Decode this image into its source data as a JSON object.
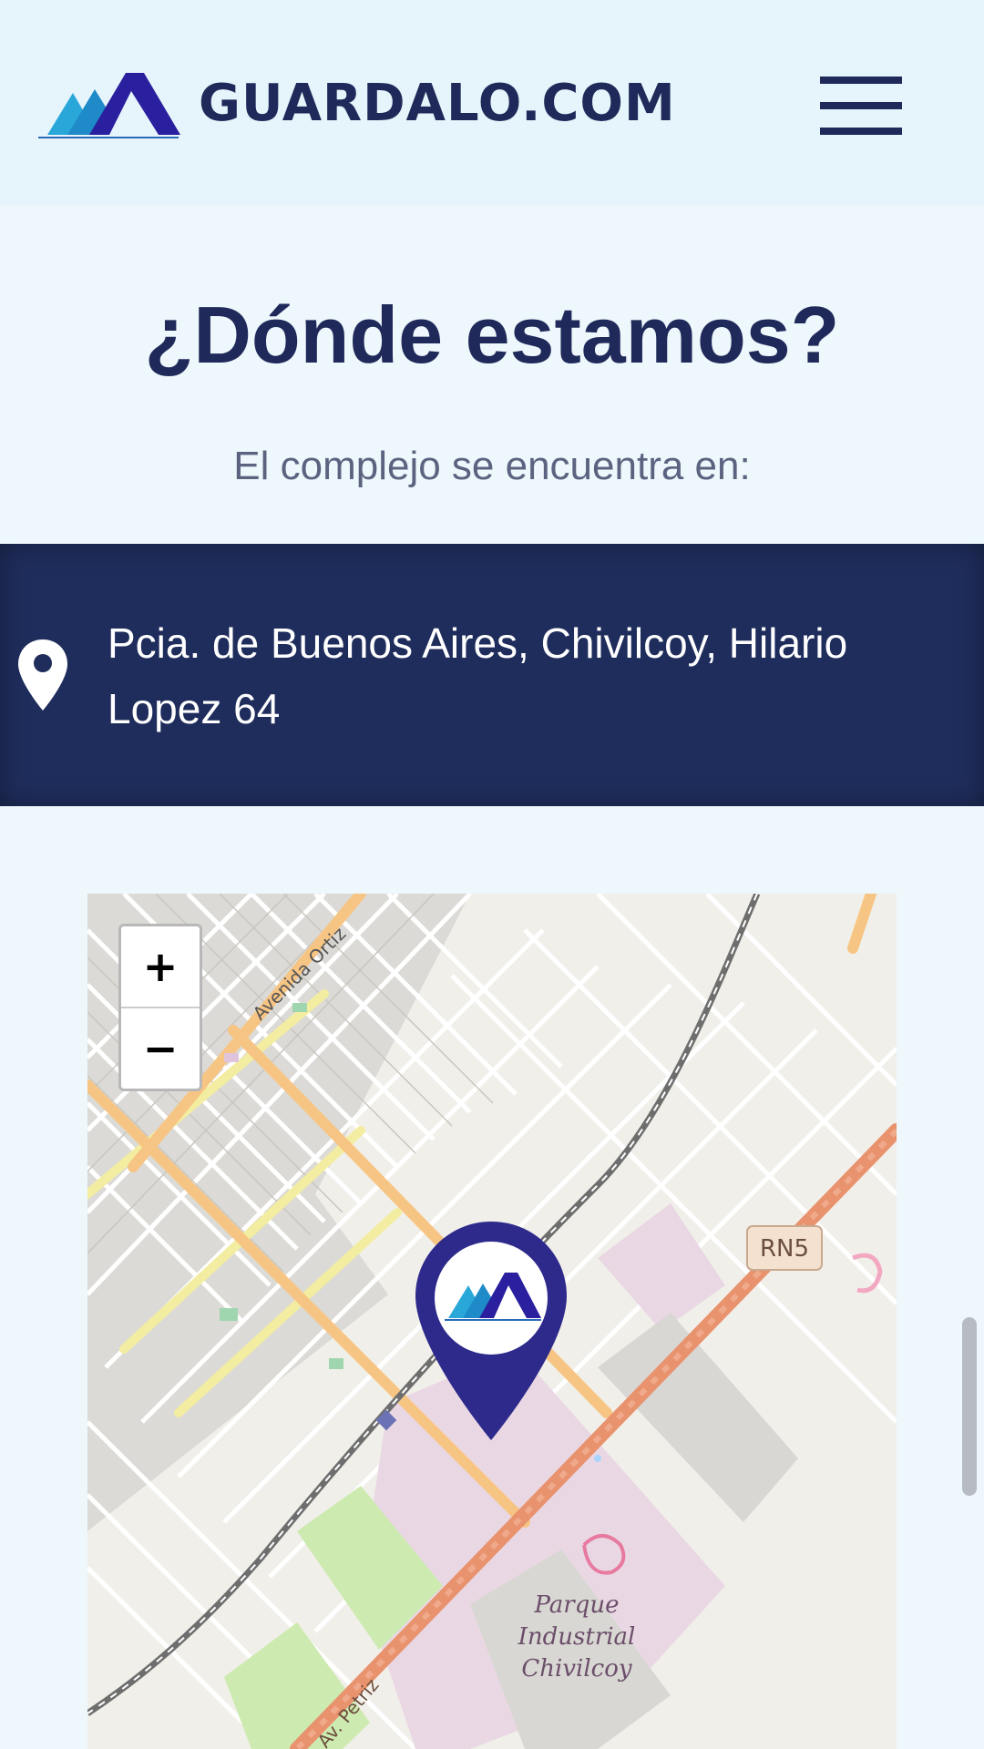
{
  "header": {
    "brand": "GUARDALO.COM",
    "logo_icon": "mountain-logo-icon",
    "menu_icon": "hamburger-menu-icon"
  },
  "section": {
    "title": "¿Dónde estamos?",
    "subtitle": "El complejo se encuentra en:"
  },
  "location": {
    "icon": "map-pin-icon",
    "address": "Pcia. de Buenos Aires, Chivilcoy, Hilario Lopez 64"
  },
  "map": {
    "zoom_in_label": "+",
    "zoom_out_label": "−",
    "labels": {
      "street_ortiz": "Avenida Ortiz",
      "route": "RN5",
      "park_line1": "Parque",
      "park_line2": "Industrial",
      "park_line3": "Chivilcoy",
      "street_petriz": "Av. Petriz"
    },
    "marker_icon": "location-marker-icon"
  },
  "colors": {
    "navy": "#1f2a5a",
    "address_bg": "#1f2d5c",
    "page_bg": "#eef7fc",
    "header_bg": "#e6f5fb",
    "marker": "#2e2a8c"
  }
}
